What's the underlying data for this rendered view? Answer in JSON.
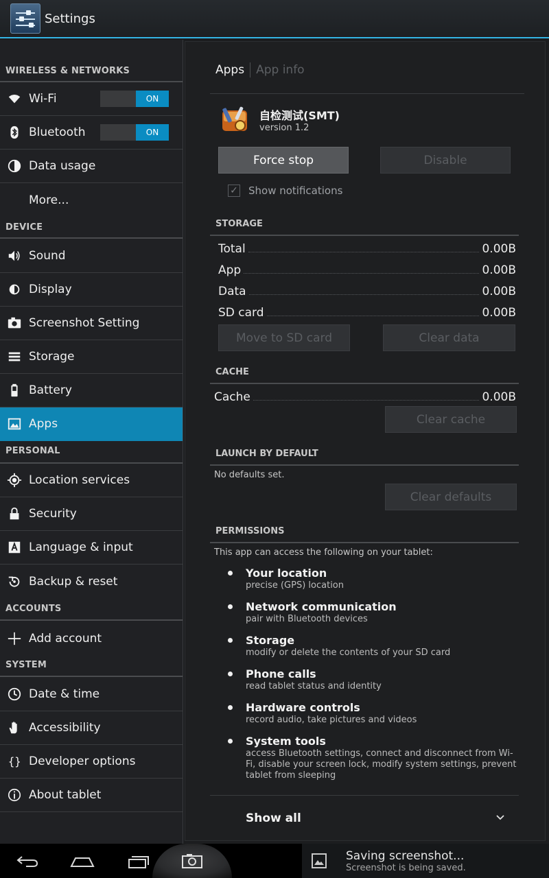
{
  "actionbar": {
    "title": "Settings"
  },
  "sidebar": {
    "sections": [
      {
        "header": "WIRELESS & NETWORKS",
        "items": [
          {
            "label": "Wi-Fi",
            "toggle": "ON"
          },
          {
            "label": "Bluetooth",
            "toggle": "ON"
          },
          {
            "label": "Data usage"
          },
          {
            "label": "More..."
          }
        ]
      },
      {
        "header": "DEVICE",
        "items": [
          {
            "label": "Sound"
          },
          {
            "label": "Display"
          },
          {
            "label": "Screenshot Setting"
          },
          {
            "label": "Storage"
          },
          {
            "label": "Battery"
          },
          {
            "label": "Apps",
            "selected": true
          }
        ]
      },
      {
        "header": "PERSONAL",
        "items": [
          {
            "label": "Location services"
          },
          {
            "label": "Security"
          },
          {
            "label": "Language & input"
          },
          {
            "label": "Backup & reset"
          }
        ]
      },
      {
        "header": "ACCOUNTS",
        "items": [
          {
            "label": "Add account"
          }
        ]
      },
      {
        "header": "SYSTEM",
        "items": [
          {
            "label": "Date & time"
          },
          {
            "label": "Accessibility"
          },
          {
            "label": "Developer options"
          },
          {
            "label": "About tablet"
          }
        ]
      }
    ]
  },
  "detail": {
    "breadcrumb": {
      "current": "Apps",
      "next": "App info"
    },
    "app": {
      "name": "自检测试(SMT)",
      "version": "version 1.2"
    },
    "buttons": {
      "force_stop": "Force stop",
      "disable": "Disable"
    },
    "show_notifications": "Show notifications",
    "storage": {
      "header": "STORAGE",
      "rows": [
        {
          "label": "Total",
          "value": "0.00B"
        },
        {
          "label": "App",
          "value": "0.00B"
        },
        {
          "label": "Data",
          "value": "0.00B"
        },
        {
          "label": "SD card",
          "value": "0.00B"
        }
      ],
      "move_button": "Move to SD card",
      "clear_data_button": "Clear data"
    },
    "cache": {
      "header": "CACHE",
      "row": {
        "label": "Cache",
        "value": "0.00B"
      },
      "clear_button": "Clear cache"
    },
    "launch": {
      "header": "LAUNCH BY DEFAULT",
      "note": "No defaults set.",
      "clear_button": "Clear defaults"
    },
    "permissions": {
      "header": "PERMISSIONS",
      "intro": "This app can access the following on your tablet:",
      "items": [
        {
          "title": "Your location",
          "desc": "precise (GPS) location"
        },
        {
          "title": "Network communication",
          "desc": "pair with Bluetooth devices"
        },
        {
          "title": "Storage",
          "desc": "modify or delete the contents of your SD card"
        },
        {
          "title": "Phone calls",
          "desc": "read tablet status and identity"
        },
        {
          "title": "Hardware controls",
          "desc": "record audio, take pictures and videos"
        },
        {
          "title": "System tools",
          "desc": "access Bluetooth settings, connect and disconnect from Wi-Fi, disable your screen lock, modify system settings, prevent tablet from sleeping"
        }
      ]
    },
    "show_all": "Show all"
  },
  "notification": {
    "title": "Saving screenshot...",
    "subtitle": "Screenshot is being saved."
  },
  "colors": {
    "accent": "#33b5e5",
    "selected": "#0f86b4",
    "toggle_on": "#0a8cc2"
  }
}
